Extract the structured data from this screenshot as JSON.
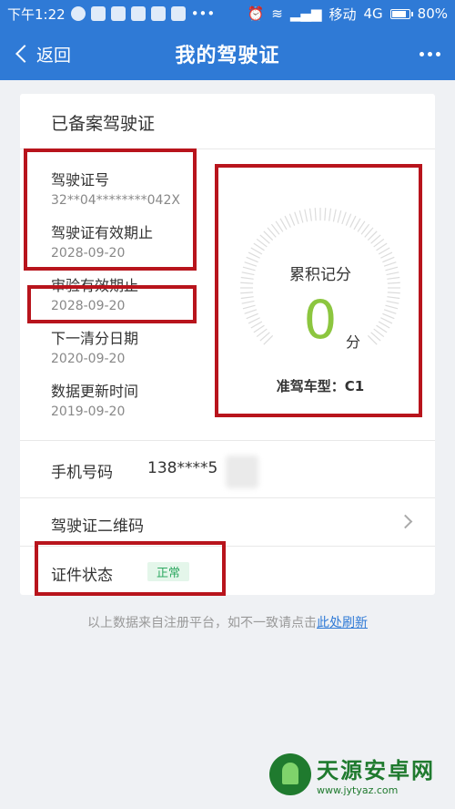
{
  "statusbar": {
    "time": "下午1:22",
    "carrier": "移动",
    "network": "4G",
    "battery": "80%"
  },
  "navbar": {
    "back_label": "返回",
    "title": "我的驾驶证"
  },
  "license": {
    "section_title": "已备案驾驶证",
    "fields": [
      {
        "label": "驾驶证号",
        "value": "32**04********042X"
      },
      {
        "label": "驾驶证有效期止",
        "value": "2028-09-20"
      },
      {
        "label": "审验有效期止",
        "value": "2028-09-20"
      },
      {
        "label": "下一清分日期",
        "value": "2020-09-20"
      },
      {
        "label": "数据更新时间",
        "value": "2019-09-20"
      }
    ]
  },
  "score": {
    "label": "累积记分",
    "value": "0",
    "unit": "分",
    "vehicle_type": "准驾车型：C1"
  },
  "phone": {
    "label": "手机号码",
    "value": "138****5"
  },
  "qrcode": {
    "label": "驾驶证二维码"
  },
  "status": {
    "label": "证件状态",
    "badge": "正常"
  },
  "footer": {
    "note": "以上数据来自注册平台，如不一致请点击",
    "link": "此处刷新"
  },
  "watermark": {
    "main": "天源安卓网",
    "sub": "www.jytyaz.com"
  },
  "colors": {
    "primary": "#2f7ad6",
    "score_green": "#8cc63f",
    "highlight_red": "#b8141c",
    "badge_green": "#2ea861"
  }
}
